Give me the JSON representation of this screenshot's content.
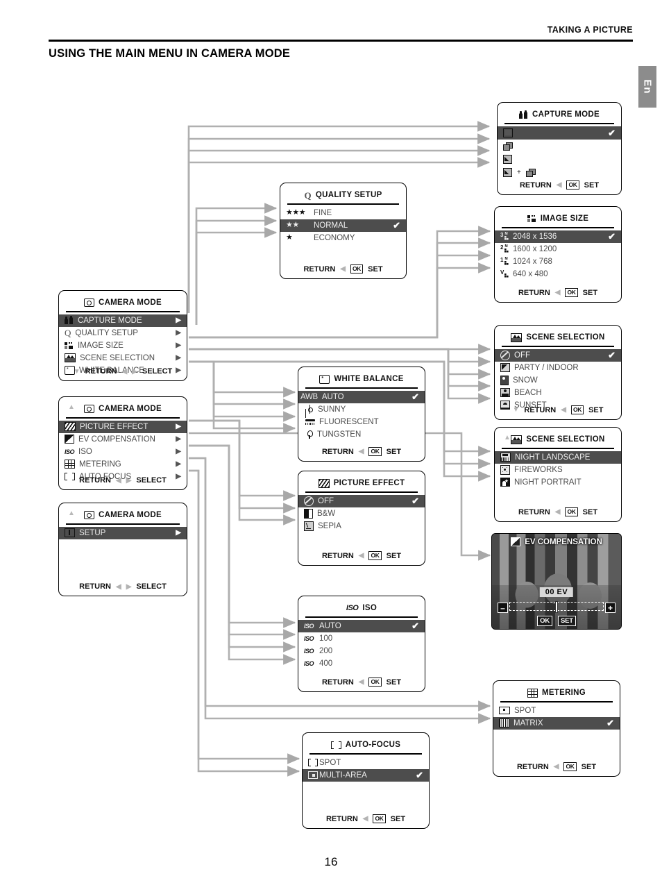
{
  "header": {
    "section": "TAKING A PICTURE",
    "title": "USING THE MAIN MENU IN CAMERA MODE",
    "lang_tab": "En",
    "page_number": "16"
  },
  "common": {
    "return": "RETURN",
    "select": "SELECT",
    "set": "SET",
    "ok": "OK",
    "check": "✔",
    "left_tri": "◀",
    "right_tri": "▶",
    "up_tri": "▲",
    "down_tri": "▼"
  },
  "panels": {
    "camera_mode_1": {
      "title": "CAMERA MODE",
      "icon": "camera-icon",
      "items": [
        {
          "label": "CAPTURE MODE",
          "icon": "people-icon",
          "selected": true,
          "arrow": "▶"
        },
        {
          "label": "QUALITY SETUP",
          "icon": "q-icon",
          "selected": false,
          "arrow": "▶"
        },
        {
          "label": "IMAGE SIZE",
          "icon": "image-size-icon",
          "selected": false,
          "arrow": "▶"
        },
        {
          "label": "SCENE SELECTION",
          "icon": "scene-icon",
          "selected": false,
          "arrow": "▶"
        },
        {
          "label": "WHITE BALANCE",
          "icon": "white-balance-icon",
          "selected": false,
          "arrow": "▶"
        }
      ],
      "footer": {
        "return": "RETURN",
        "select": "SELECT",
        "down": "▼",
        "left": "◀",
        "right": "▶"
      }
    },
    "camera_mode_2": {
      "title": "CAMERA MODE",
      "icon": "camera-icon",
      "up": "▲",
      "items": [
        {
          "label": "PICTURE EFFECT",
          "icon": "hatch-icon",
          "selected": true,
          "arrow": "▶"
        },
        {
          "label": "EV COMPENSATION",
          "icon": "ev-icon",
          "selected": false,
          "arrow": "▶"
        },
        {
          "label": "ISO",
          "icon": "iso-icon",
          "selected": false,
          "arrow": "▶"
        },
        {
          "label": "METERING",
          "icon": "grid-icon",
          "selected": false,
          "arrow": "▶"
        },
        {
          "label": "AUTO FOCUS",
          "icon": "af-icon",
          "selected": false,
          "arrow": "▶"
        }
      ],
      "footer": {
        "return": "RETURN",
        "select": "SELECT",
        "left": "◀",
        "right": "▶"
      }
    },
    "camera_mode_3": {
      "title": "CAMERA MODE",
      "icon": "camera-icon",
      "up": "▲",
      "items": [
        {
          "label": "SETUP",
          "icon": "setup-icon",
          "selected": true,
          "arrow": "▶"
        }
      ],
      "footer": {
        "return": "RETURN",
        "select": "SELECT",
        "left": "◀",
        "right": "▶"
      }
    },
    "capture_mode": {
      "title": "CAPTURE MODE",
      "icon": "people-icon",
      "items": [
        {
          "label": "",
          "icon": "single-frame-icon",
          "selected": true,
          "check": "✔"
        },
        {
          "label": "",
          "icon": "burst-icon",
          "selected": false
        },
        {
          "label": "",
          "icon": "timelapse-icon",
          "selected": false
        },
        {
          "label": "",
          "icon": "timelapse-plus-burst-icon",
          "selected": false
        }
      ],
      "footer": {
        "return": "RETURN",
        "ok": "OK",
        "set": "SET",
        "left": "◀"
      }
    },
    "quality_setup": {
      "title": "QUALITY SETUP",
      "icon": "q-icon",
      "items": [
        {
          "label": "FINE",
          "stars": "★★★",
          "selected": false
        },
        {
          "label": "NORMAL",
          "stars": "★★",
          "selected": true,
          "check": "✔"
        },
        {
          "label": "ECONOMY",
          "stars": "★",
          "selected": false
        }
      ],
      "footer": {
        "return": "RETURN",
        "ok": "OK",
        "set": "SET",
        "left": "◀"
      }
    },
    "image_size": {
      "title": "IMAGE SIZE",
      "icon": "image-size-icon",
      "items": [
        {
          "label": "2048 x 1536",
          "badge": "3",
          "badge_sup": "M",
          "selected": true,
          "check": "✔"
        },
        {
          "label": "1600 x 1200",
          "badge": "2",
          "badge_sup": "M",
          "selected": false
        },
        {
          "label": "1024 x 768",
          "badge": "1",
          "badge_sup": "M",
          "selected": false
        },
        {
          "label": "640 x 480",
          "badge": "V",
          "badge_sup": "",
          "selected": false
        }
      ],
      "footer": {
        "return": "RETURN",
        "ok": "OK",
        "set": "SET",
        "left": "◀"
      }
    },
    "scene_selection_1": {
      "title": "SCENE SELECTION",
      "icon": "scene-icon",
      "items": [
        {
          "label": "OFF",
          "icon": "off-icon",
          "selected": true,
          "check": "✔"
        },
        {
          "label": "PARTY / INDOOR",
          "icon": "party-icon",
          "selected": false
        },
        {
          "label": "SNOW",
          "icon": "snow-icon",
          "selected": false
        },
        {
          "label": "BEACH",
          "icon": "beach-icon",
          "selected": false
        },
        {
          "label": "SUNSET",
          "icon": "sunset-icon",
          "selected": false
        }
      ],
      "footer": {
        "return": "RETURN",
        "ok": "OK",
        "set": "SET",
        "left": "◀",
        "down": "▼"
      }
    },
    "scene_selection_2": {
      "title": "SCENE SELECTION",
      "icon": "scene-icon",
      "up": "▲",
      "items": [
        {
          "label": "NIGHT LANDSCAPE",
          "icon": "night-landscape-icon",
          "selected": true
        },
        {
          "label": "FIREWORKS",
          "icon": "fireworks-icon",
          "selected": false
        },
        {
          "label": "NIGHT PORTRAIT",
          "icon": "night-portrait-icon",
          "selected": false
        }
      ],
      "footer": {
        "return": "RETURN",
        "ok": "OK",
        "set": "SET",
        "left": "◀"
      }
    },
    "white_balance": {
      "title": "WHITE BALANCE",
      "icon": "white-balance-icon",
      "items": [
        {
          "label": "AUTO",
          "badge": "AWB",
          "selected": true,
          "check": "✔"
        },
        {
          "label": "SUNNY",
          "icon": "sun-icon",
          "selected": false
        },
        {
          "label": "FLUORESCENT",
          "icon": "fluorescent-icon",
          "selected": false
        },
        {
          "label": "TUNGSTEN",
          "icon": "tungsten-icon",
          "selected": false
        }
      ],
      "footer": {
        "return": "RETURN",
        "ok": "OK",
        "set": "SET",
        "left": "◀"
      }
    },
    "picture_effect": {
      "title": "PICTURE EFFECT",
      "icon": "hatch-icon",
      "items": [
        {
          "label": "OFF",
          "icon": "off-icon",
          "selected": true,
          "check": "✔"
        },
        {
          "label": "B&W",
          "icon": "bw-icon",
          "selected": false
        },
        {
          "label": "SEPIA",
          "icon": "sepia-icon",
          "selected": false
        }
      ],
      "footer": {
        "return": "RETURN",
        "ok": "OK",
        "set": "SET",
        "left": "◀"
      }
    },
    "iso": {
      "title": "ISO",
      "icon": "iso-icon",
      "items": [
        {
          "label": "AUTO",
          "icon": "iso-auto-icon",
          "selected": true,
          "check": "✔"
        },
        {
          "label": "100",
          "icon": "iso-100-icon",
          "selected": false
        },
        {
          "label": "200",
          "icon": "iso-200-icon",
          "selected": false
        },
        {
          "label": "400",
          "icon": "iso-400-icon",
          "selected": false
        }
      ],
      "footer": {
        "return": "RETURN",
        "ok": "OK",
        "set": "SET",
        "left": "◀"
      }
    },
    "metering": {
      "title": "METERING",
      "icon": "grid-icon",
      "items": [
        {
          "label": "SPOT",
          "icon": "spot-metering-icon",
          "selected": false
        },
        {
          "label": "MATRIX",
          "icon": "matrix-metering-icon",
          "selected": true,
          "check": "✔"
        }
      ],
      "footer": {
        "return": "RETURN",
        "ok": "OK",
        "set": "SET",
        "left": "◀"
      }
    },
    "auto_focus": {
      "title": "AUTO-FOCUS",
      "icon": "af-icon",
      "items": [
        {
          "label": "SPOT",
          "icon": "af-spot-icon",
          "selected": false
        },
        {
          "label": "MULTI-AREA",
          "icon": "af-multi-icon",
          "selected": true,
          "check": "✔"
        }
      ],
      "footer": {
        "return": "RETURN",
        "ok": "OK",
        "set": "SET",
        "left": "◀"
      }
    },
    "ev_compensation": {
      "title": "EV COMPENSATION",
      "icon": "ev-icon",
      "value": "00  EV",
      "minus": "–",
      "plus": "+",
      "ok": "OK",
      "set": "SET"
    }
  }
}
